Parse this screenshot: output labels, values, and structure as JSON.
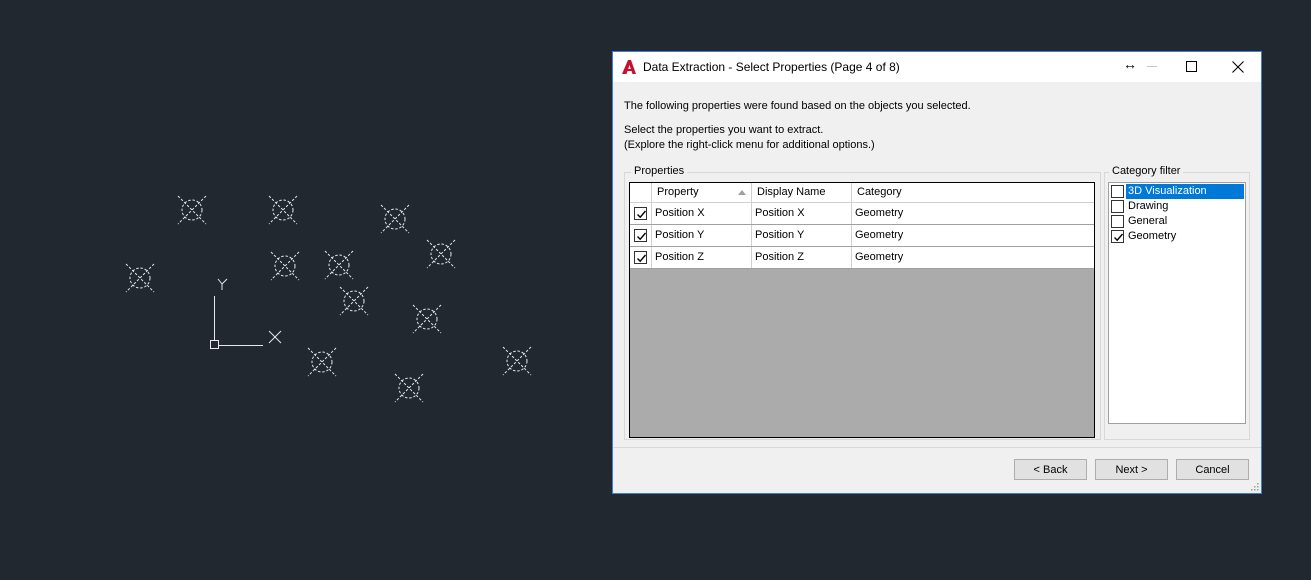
{
  "colors": {
    "cad_background": "#212830",
    "cad_lines": "#e8e8e8",
    "dialog_background": "#f0f0f0",
    "dialog_border": "#3c7fd8",
    "selection_blue": "#0078d7",
    "grid_empty": "#ababab",
    "autocad_red": "#c8102e"
  },
  "dialog": {
    "title": "Data Extraction - Select Properties (Page 4 of 8)",
    "intro": "The following properties were found based on the objects you selected.",
    "instruction_line1": "Select the properties you want to extract.",
    "instruction_line2": "(Explore the right-click menu for additional options.)"
  },
  "properties": {
    "group_label": "Properties",
    "columns": [
      "Property",
      "Display Name",
      "Category"
    ],
    "rows": [
      {
        "checked": true,
        "property": "Position X",
        "display_name": "Position X",
        "category": "Geometry"
      },
      {
        "checked": true,
        "property": "Position Y",
        "display_name": "Position Y",
        "category": "Geometry"
      },
      {
        "checked": true,
        "property": "Position Z",
        "display_name": "Position Z",
        "category": "Geometry"
      }
    ]
  },
  "category_filter": {
    "group_label": "Category filter",
    "items": [
      {
        "label": "3D Visualization",
        "checked": false,
        "selected": true
      },
      {
        "label": "Drawing",
        "checked": false,
        "selected": false
      },
      {
        "label": "General",
        "checked": false,
        "selected": false
      },
      {
        "label": "Geometry",
        "checked": true,
        "selected": false
      }
    ]
  },
  "buttons": {
    "back": "< Back",
    "next": "Next >",
    "cancel": "Cancel"
  },
  "ucs": {
    "x_label": "X",
    "y_label": "Y"
  }
}
